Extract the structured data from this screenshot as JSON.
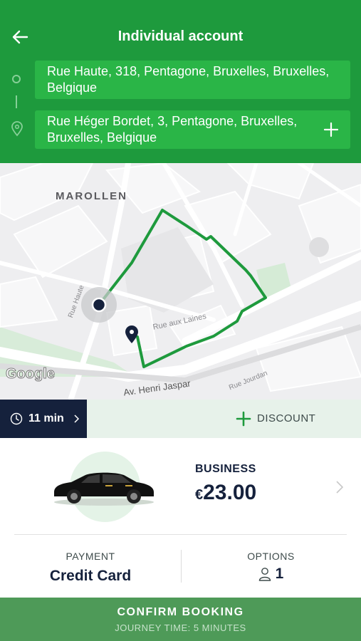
{
  "header": {
    "title": "Individual account",
    "back_icon": "back-arrow-icon",
    "pickup_address": "Rue Haute, 318, Pentagone, Bruxelles, Bruxelles, Belgique",
    "dropoff_address": "Rue Héger Bordet, 3, Pentagone, Bruxelles, Bruxelles, Belgique",
    "add_stop_icon": "plus-icon"
  },
  "map": {
    "district_label": "MAROLLEN",
    "streets": [
      "Rue Haute",
      "Rue aux Laines",
      "Av. Henri Jaspar",
      "Rue Jourdan"
    ],
    "google_logo": "Google",
    "route_color": "#1e9a3d"
  },
  "eta_bar": {
    "eta": "11 min",
    "discount_label": "DISCOUNT"
  },
  "vehicle": {
    "class": "BUSINESS",
    "currency": "€",
    "amount": "23.00"
  },
  "payment": {
    "label": "PAYMENT",
    "value": "Credit Card"
  },
  "options": {
    "label": "OPTIONS",
    "passengers": "1"
  },
  "confirm": {
    "label": "CONFIRM BOOKING",
    "journey_time": "JOURNEY TIME: 5 MINUTES"
  },
  "colors": {
    "brand_green": "#1e9a3d",
    "address_green": "#2ab547",
    "navy": "#15213c",
    "confirm_green": "#4e9a58"
  }
}
